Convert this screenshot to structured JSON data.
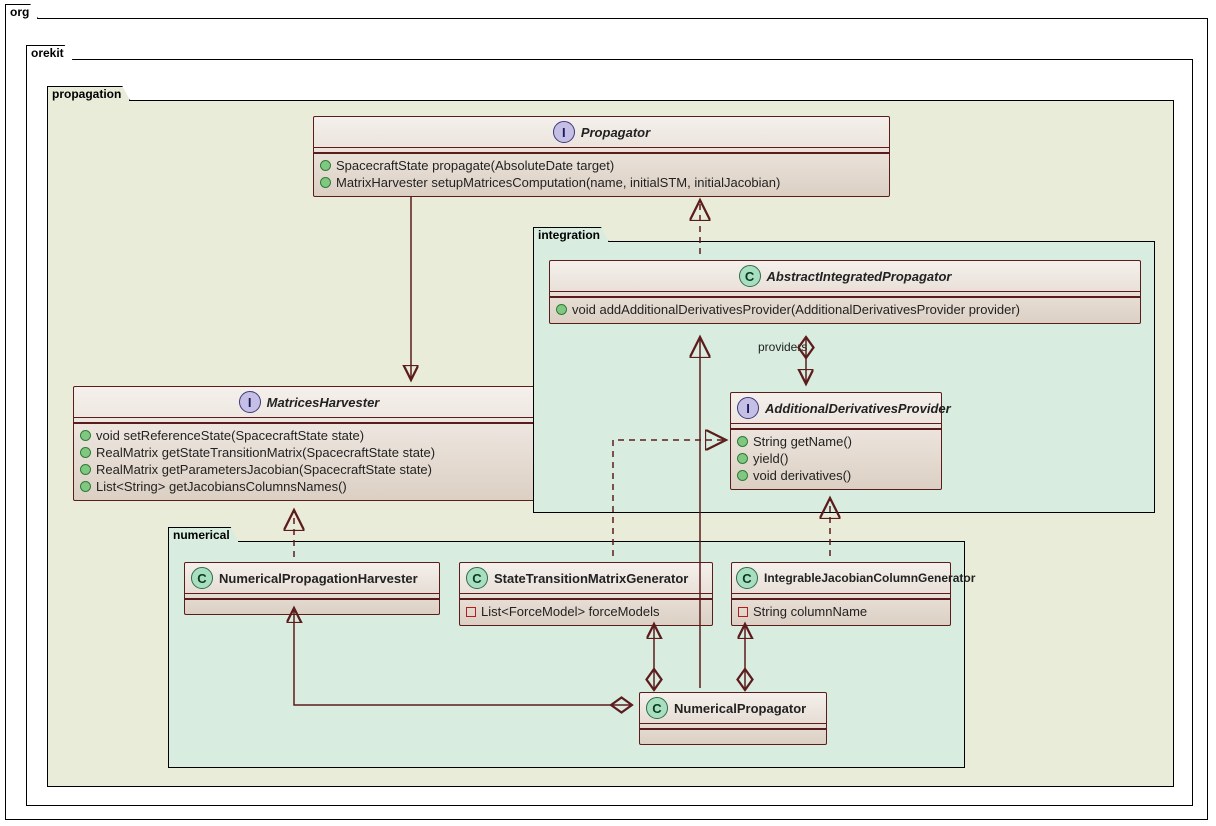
{
  "packages": {
    "org": "org",
    "orekit": "orekit",
    "propagation": "propagation",
    "integration": "integration",
    "numerical": "numerical"
  },
  "classes": {
    "Propagator": {
      "stereotype": "I",
      "name": "Propagator",
      "members": [
        "SpacecraftState propagate(AbsoluteDate target)",
        "MatrixHarvester setupMatricesComputation(name, initialSTM, initialJacobian)"
      ]
    },
    "MatricesHarvester": {
      "stereotype": "I",
      "name": "MatricesHarvester",
      "members": [
        "void setReferenceState(SpacecraftState state)",
        "RealMatrix getStateTransitionMatrix(SpacecraftState state)",
        "RealMatrix getParametersJacobian(SpacecraftState state)",
        "List<String> getJacobiansColumnsNames()"
      ]
    },
    "AbstractIntegratedPropagator": {
      "stereotype": "C",
      "name": "AbstractIntegratedPropagator",
      "members": [
        "void addAdditionalDerivativesProvider(AdditionalDerivativesProvider provider)"
      ]
    },
    "AdditionalDerivativesProvider": {
      "stereotype": "I",
      "name": "AdditionalDerivativesProvider",
      "members": [
        "String getName()",
        "yield()",
        "void derivatives()"
      ]
    },
    "NumericalPropagationHarvester": {
      "stereotype": "C",
      "name": "NumericalPropagationHarvester",
      "members": []
    },
    "StateTransitionMatrixGenerator": {
      "stereotype": "C",
      "name": "StateTransitionMatrixGenerator",
      "members_sq": [
        "List<ForceModel> forceModels"
      ]
    },
    "IntegrableJacobianColumnGenerator": {
      "stereotype": "C",
      "name": "IntegrableJacobianColumnGenerator",
      "members_sq": [
        "String columnName"
      ]
    },
    "NumericalPropagator": {
      "stereotype": "C",
      "name": "NumericalPropagator",
      "members": []
    }
  },
  "labels": {
    "providers": "providers"
  }
}
